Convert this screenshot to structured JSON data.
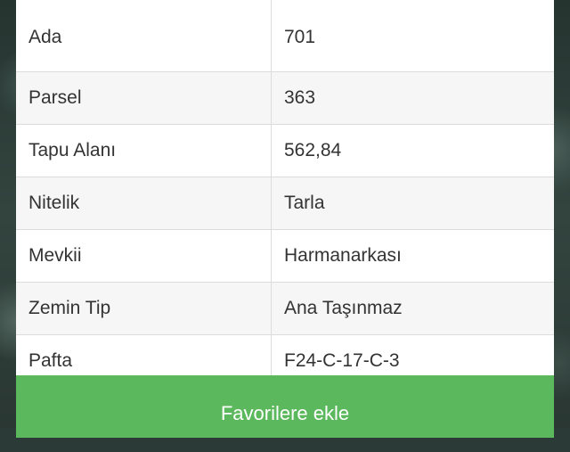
{
  "details": {
    "rows": [
      {
        "label": "Ada",
        "value": "701"
      },
      {
        "label": "Parsel",
        "value": "363"
      },
      {
        "label": "Tapu Alanı",
        "value": "562,84"
      },
      {
        "label": "Nitelik",
        "value": "Tarla"
      },
      {
        "label": "Mevkii",
        "value": "Harmanarkası"
      },
      {
        "label": "Zemin Tip",
        "value": "Ana Taşınmaz"
      },
      {
        "label": "Pafta",
        "value": "F24-C-17-C-3"
      }
    ]
  },
  "actions": {
    "favorite_label": "Favorilere ekle"
  },
  "colors": {
    "accent": "#5cb85c",
    "row_alt": "#f6f6f6",
    "border": "#dcdcdc",
    "text": "#333333"
  }
}
